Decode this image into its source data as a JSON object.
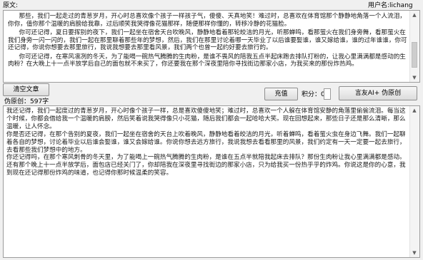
{
  "header": {
    "original_label": "原文:",
    "username_label": "用户名:lichang"
  },
  "source_text": {
    "paragraphs": [
      "那些，我们一起走过的青葱岁月，开心时总喜欢像个孩子一样孩子气，傻傻、天真地笑！难过时，总喜欢在体育馆那个静静地角落一个人流泪，你你，值你那个温暖的肩膀给我靠，过后顺笑我哭得像花猫那样，随便那样你懂的，转移冷静的花猫脸。",
      "你可还记得，夏日要挥别的夜下，我们一起坐在宿舍天台吹晚风，静静地看着那轮皎洁的月光，听那蝉鸣，看那萤火在我们身旁舞，看那萤火在我们身旁一闪一闪的，我们一起在那里聊着那些年的梦想，然后，我们在那里讨论着哪一天毕业了以后谁要娶谁，谁又嫁给谁，谁的过年谁谁，你可还记得，你说你想要去那里旅行，我说我想要去那里看风景，我们两个也曾一起约好要去旅行的。",
      "你可还记得，在寒风凛冽的冬天，为了能喝一碗热气腾腾的生肉粉，是谁不畏风的陪我五点半起床跑去排队打粉的，让我心里满满都是感动的生肉粉？在大晚上十一点半放学后自己的面包就不来买了，你还要我在那个深夜里陪你寻找街边那家小店，为我买来的那份炸热鸡。"
    ]
  },
  "left_button": {
    "label": "清空文章"
  },
  "word_count": "伪原创：597字",
  "center_button": {
    "label": "充值"
  },
  "score_label": "积分：0",
  "right_button": {
    "label": "言友AI+ 伪原创"
  },
  "output_text": {
    "paragraphs": [
      "我还记得，我们一起度过的青葱岁月，开心时像个孩子一样，总是喜欢傻傻地笑；难过时，总喜欢一个人躲在体育馆安静的角落里偷偷流泪。每当这个时候，你都会借给我一个温暖的肩膀，然后笑着说我哭得像只小花猫，随后我们都会一起哈哈大笑。现在回想起来，那些日子还是那么清晰，那么温暖，让人怀念。",
      "你是否还记得，在那个告别的夏夜，我们一起坐在宿舍的天台上吹着晚风，静静地看着皎洁的月光，听着蝉鸣，看着萤火虫在身边飞舞。我们一起聊着各自的梦想，讨论着毕业以后谁会娶谁，谁又会嫁给谁。你说你想去远方旅行，我说我想去看看那里的风景，我们约定有一天一定要一起去旅行，去看那些我们梦想中的地方。",
      "你还记得吗，在那个寒风刺骨的冬天里，为了能喝上一碗热气腾腾的生肉粉，是谁在五点半就陪我起床去排队？那份生肉粉让我心里满满都是感动。还有那个晚上十一点半放学后，面包店已经关门了，你却陪我在深夜里寻找街边的那家小店，只为给我买一份热乎乎的炸鸡。你说这是你的心意，我到现在还记得那份炸鸡的味道，也记得你那时候温柔的笑容。"
    ]
  }
}
